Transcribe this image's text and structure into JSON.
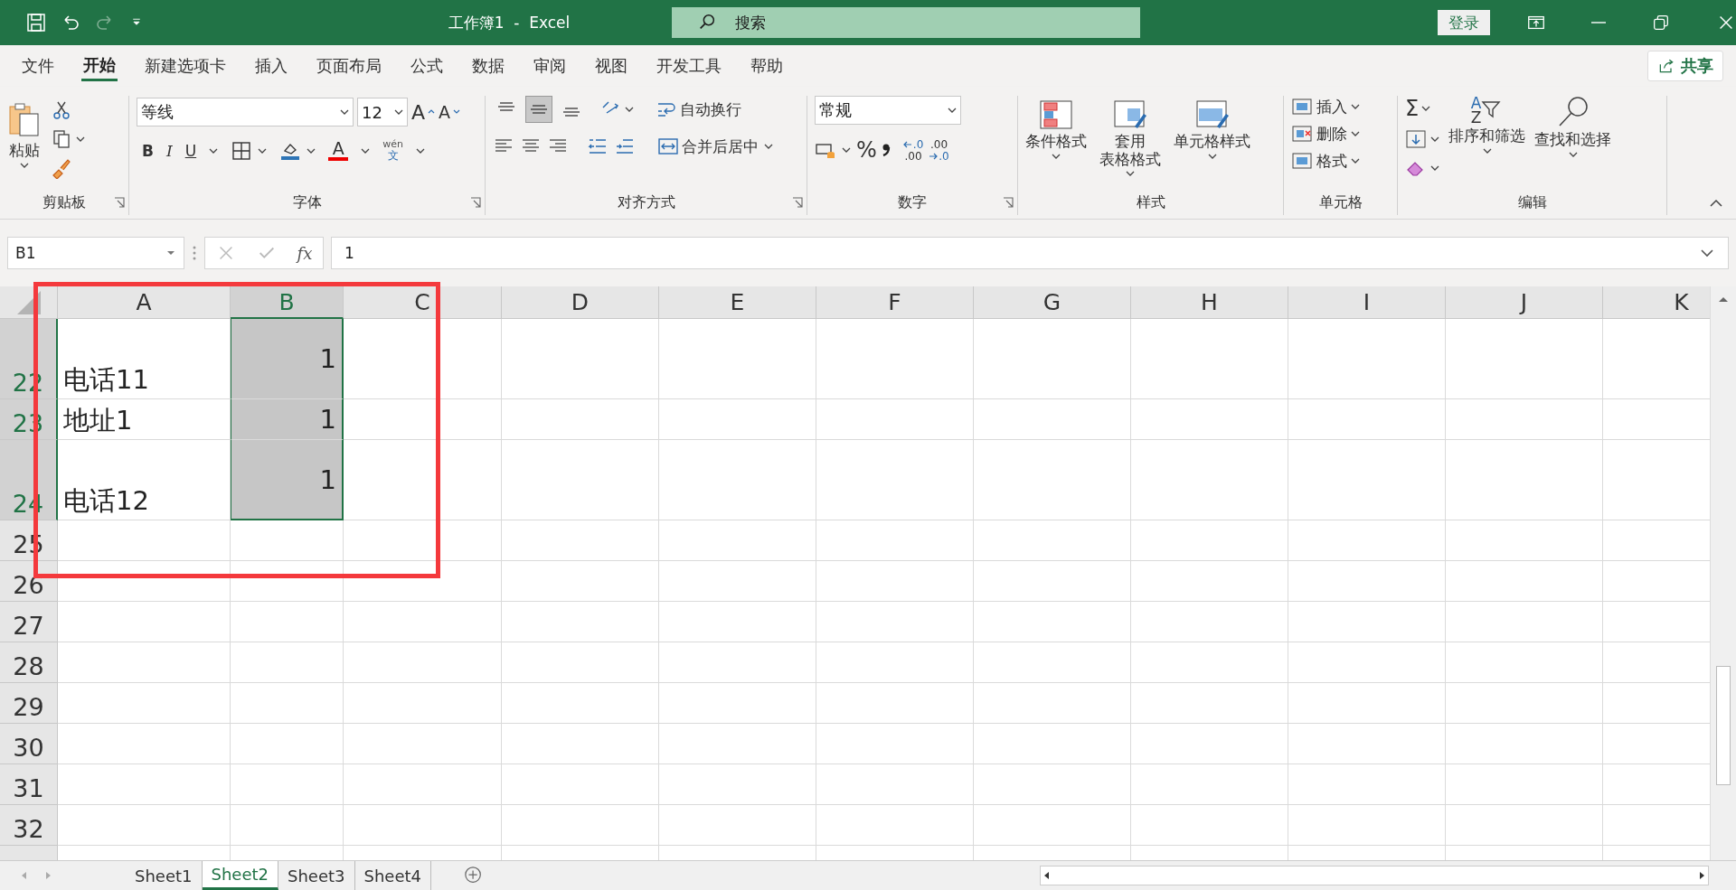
{
  "window": {
    "title": "工作簿1  -  Excel"
  },
  "search": {
    "placeholder": "搜索"
  },
  "sign_in": "登录",
  "menu_tabs": [
    {
      "label": "文件",
      "selected": false
    },
    {
      "label": "开始",
      "selected": true
    },
    {
      "label": "新建选项卡",
      "selected": false
    },
    {
      "label": "插入",
      "selected": false
    },
    {
      "label": "页面布局",
      "selected": false
    },
    {
      "label": "公式",
      "selected": false
    },
    {
      "label": "数据",
      "selected": false
    },
    {
      "label": "审阅",
      "selected": false
    },
    {
      "label": "视图",
      "selected": false
    },
    {
      "label": "开发工具",
      "selected": false
    },
    {
      "label": "帮助",
      "selected": false
    }
  ],
  "share": "共享",
  "ribbon": {
    "clipboard": {
      "label": "剪贴板",
      "paste": "粘贴"
    },
    "font": {
      "label": "字体",
      "font_name": "等线",
      "font_size": "12",
      "grow": "A",
      "shrink": "A",
      "bold": "B",
      "italic": "I",
      "underline": "U",
      "font_color": "A",
      "phonetic_top": "wén",
      "phonetic_bottom": "文"
    },
    "alignment": {
      "label": "对齐方式",
      "vertical_align": [
        {
          "kind": "top",
          "selected": false
        },
        {
          "kind": "middle",
          "selected": true
        },
        {
          "kind": "bottom",
          "selected": false
        }
      ],
      "wrap_text": "自动换行",
      "merge_center": "合并后居中"
    },
    "number": {
      "label": "数字",
      "format": "常规",
      "percent": "%",
      "increase_decimal": {
        "top": ".0",
        "bottom": ".00"
      },
      "decrease_decimal": {
        "top": ".00",
        "bottom": ".0"
      }
    },
    "styles": {
      "label": "样式",
      "items": [
        {
          "lines": [
            "条件格式"
          ]
        },
        {
          "lines": [
            "套用",
            "表格格式"
          ]
        },
        {
          "lines": [
            "单元格样式"
          ]
        }
      ]
    },
    "cells": {
      "label": "单元格",
      "items": [
        "插入",
        "删除",
        "格式"
      ]
    },
    "editing": {
      "label": "编辑",
      "autosum": "Σ",
      "sort_letters": [
        "A",
        "Z"
      ],
      "sort_filter": "排序和筛选",
      "find_select": "查找和选择"
    }
  },
  "formula_bar": {
    "name_box": "B1",
    "function_symbol": "fx",
    "value": "1"
  },
  "grid": {
    "columns": [
      {
        "label": "A",
        "selected": false
      },
      {
        "label": "B",
        "selected": true
      },
      {
        "label": "C",
        "selected": false
      },
      {
        "label": "D",
        "selected": false
      },
      {
        "label": "E",
        "selected": false
      },
      {
        "label": "F",
        "selected": false
      },
      {
        "label": "G",
        "selected": false
      },
      {
        "label": "H",
        "selected": false
      },
      {
        "label": "I",
        "selected": false
      },
      {
        "label": "J",
        "selected": false
      },
      {
        "label": "K",
        "selected": false
      }
    ],
    "rows": [
      {
        "header": "22",
        "selected": true,
        "kind": "tall",
        "cells": [
          {
            "text": "电话11",
            "selected": false
          },
          {
            "text": "1",
            "selected": true
          }
        ]
      },
      {
        "header": "23",
        "selected": true,
        "kind": "normal",
        "cells": [
          {
            "text": "地址1",
            "selected": false
          },
          {
            "text": "1",
            "selected": true
          }
        ]
      },
      {
        "header": "24",
        "selected": true,
        "kind": "tall",
        "cells": [
          {
            "text": "电话12",
            "selected": false
          },
          {
            "text": "1",
            "selected": true
          }
        ]
      },
      {
        "header": "25",
        "selected": false,
        "kind": "normal"
      },
      {
        "header": "26",
        "selected": false,
        "kind": "normal"
      },
      {
        "header": "27",
        "selected": false,
        "kind": "normal"
      },
      {
        "header": "28",
        "selected": false,
        "kind": "normal"
      },
      {
        "header": "29",
        "selected": false,
        "kind": "normal"
      },
      {
        "header": "30",
        "selected": false,
        "kind": "normal"
      },
      {
        "header": "31",
        "selected": false,
        "kind": "normal"
      },
      {
        "header": "32",
        "selected": false,
        "kind": "normal"
      }
    ]
  },
  "sheets": [
    {
      "label": "Sheet1",
      "selected": false
    },
    {
      "label": "Sheet2",
      "selected": true
    },
    {
      "label": "Sheet3",
      "selected": false
    },
    {
      "label": "Sheet4",
      "selected": false
    }
  ]
}
